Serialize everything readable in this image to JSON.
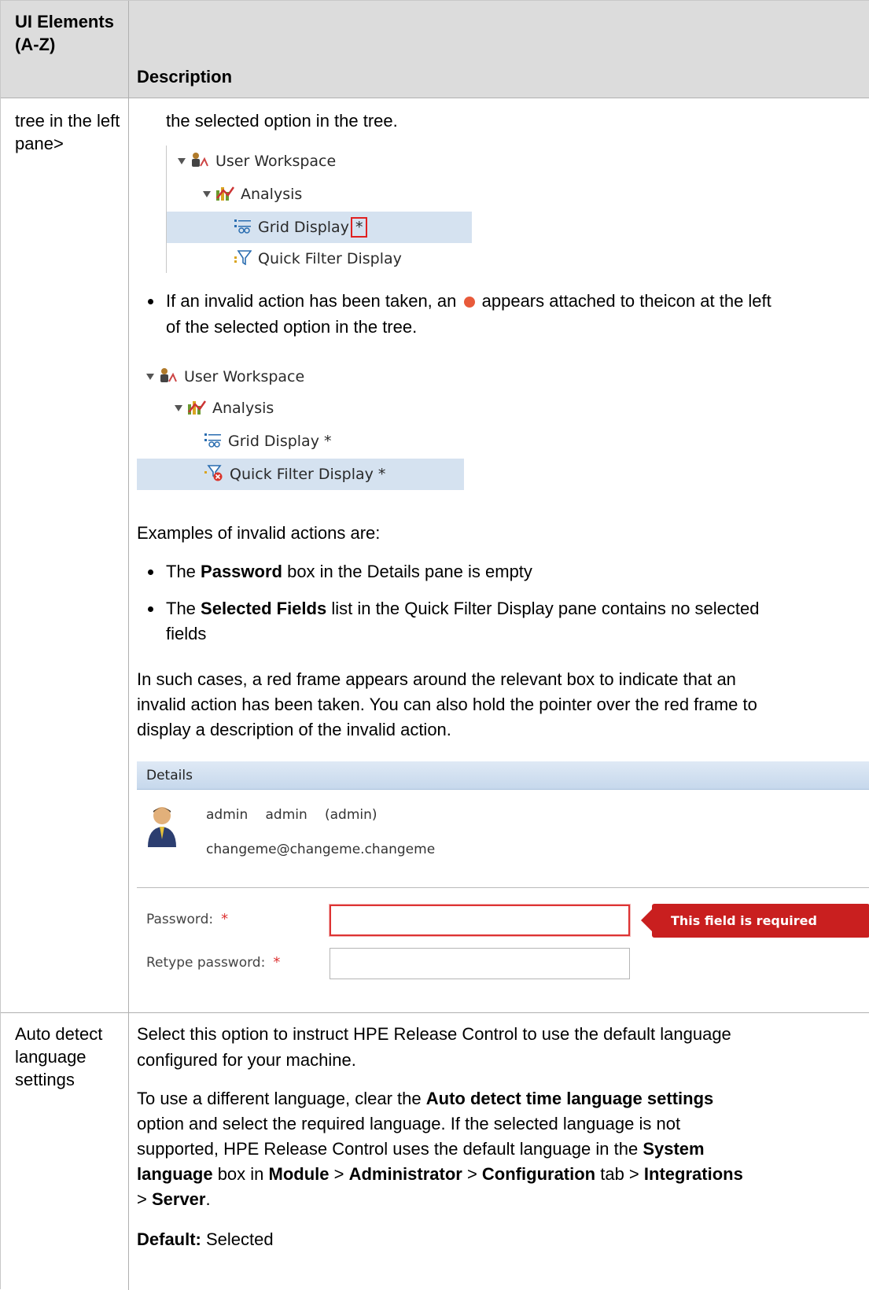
{
  "header": {
    "col1": "UI Elements (A-Z)",
    "col2": "Description"
  },
  "row1": {
    "element_label": "tree in the left pane>",
    "intro_text": "the selected option in the tree.",
    "tree1": {
      "items": [
        {
          "label": "User Workspace",
          "icon": "user-workspace-icon"
        },
        {
          "label": "Analysis",
          "icon": "analysis-chart-icon"
        },
        {
          "label": "Grid Display",
          "suffix": "*",
          "icon": "grid-display-icon",
          "selected": true
        },
        {
          "label": "Quick Filter Display",
          "icon": "quick-filter-icon"
        }
      ]
    },
    "invalid_bullet": {
      "line1_pre": "If an invalid action has been taken, an",
      "line1_post": "appears attached to theicon at the left",
      "line2": "of the selected option in the tree."
    },
    "tree2": {
      "items": [
        {
          "label": "User Workspace",
          "icon": "user-workspace-icon"
        },
        {
          "label": "Analysis",
          "icon": "analysis-chart-icon"
        },
        {
          "label": "Grid Display *",
          "icon": "grid-display-icon"
        },
        {
          "label": "Quick Filter Display *",
          "icon": "quick-filter-error-icon",
          "selected": true
        }
      ]
    },
    "examples_intro": "Examples of invalid actions are:",
    "example1": {
      "pre": "The ",
      "bold": "Password",
      "post": " box in the Details pane is empty"
    },
    "example2": {
      "pre": "The ",
      "bold": "Selected Fields",
      "post": " list in the Quick Filter Display pane contains no selected",
      "line2": "fields"
    },
    "such_cases": [
      "In such cases, a red frame appears around the relevant box to indicate that an",
      "invalid action has been taken. You can also hold the pointer over the red frame to",
      "display a description of the invalid action."
    ],
    "details_panel": {
      "title": "Details",
      "first_name": "admin",
      "last_name": "admin",
      "username": "(admin)",
      "email": "changeme@changeme.changeme",
      "password_label": "Password:",
      "retype_label": "Retype password:",
      "required_mark": "*",
      "error_tooltip": "This field is required"
    }
  },
  "row2": {
    "element_label": "Auto detect language settings",
    "p1": [
      "Select this option to instruct HPE Release Control to use the default language",
      "configured for your machine."
    ],
    "p2_l1_pre": "To use a different language, clear the ",
    "p2_l1_bold": "Auto detect time language settings",
    "p2_l2": "option and select the required language. If the selected language is not",
    "p2_l3_pre": "supported, HPE Release Control uses the default language in the ",
    "p2_l3_bold": "System",
    "p2_l4": {
      "b1": "language",
      "t1": " box in ",
      "b2": "Module",
      "t2": " > ",
      "b3": "Administrator",
      "t3": " > ",
      "b4": "Configuration",
      "t4": " tab > ",
      "b5": "Integrations"
    },
    "p2_l5": {
      "t1": "> ",
      "b1": "Server",
      "t2": "."
    },
    "default_label": "Default:",
    "default_value": " Selected"
  },
  "colors": {
    "header_bg": "#dcdcdc",
    "selected_row": "#d5e2f0",
    "error_red": "#c91f1f"
  }
}
